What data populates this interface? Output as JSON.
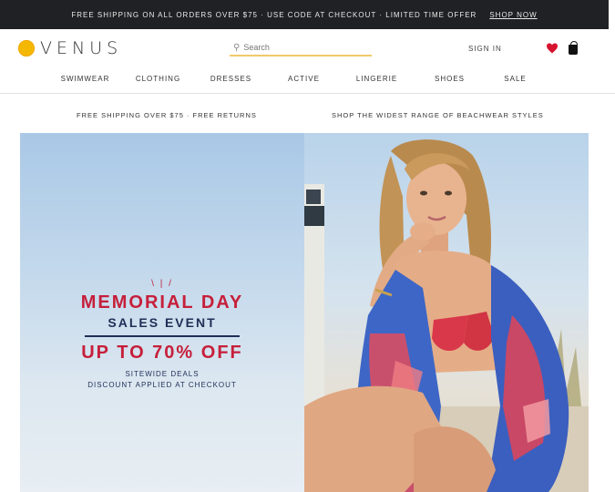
{
  "promo": {
    "message": "Free shipping on all orders over $75 · Use code at checkout · Limited time offer",
    "link": "Shop now"
  },
  "brand": {
    "name": "VENUS",
    "logo_color": "#f5b800"
  },
  "search": {
    "icon": "search-icon",
    "placeholder": "Search"
  },
  "header": {
    "account_label": "Sign in",
    "heart_color": "#d6132f"
  },
  "nav": {
    "items": [
      {
        "label": "Swimwear"
      },
      {
        "label": "Clothing"
      },
      {
        "label": "Dresses"
      },
      {
        "label": "Active"
      },
      {
        "label": "Lingerie"
      },
      {
        "label": "Shoes"
      },
      {
        "label": "Sale"
      }
    ]
  },
  "info": {
    "left": "Free shipping over $75 · Free returns",
    "right": "Shop the widest range of beachwear styles"
  },
  "hero": {
    "deco": "\\ | /",
    "title": "MEMORIAL DAY",
    "subtitle": "SALES EVENT",
    "offer": "UP TO 70% OFF",
    "fine_line1": "Sitewide deals",
    "fine_line2": "Discount applied at checkout",
    "title_color": "#c61f3a",
    "subtitle_color": "#1f2f57"
  }
}
